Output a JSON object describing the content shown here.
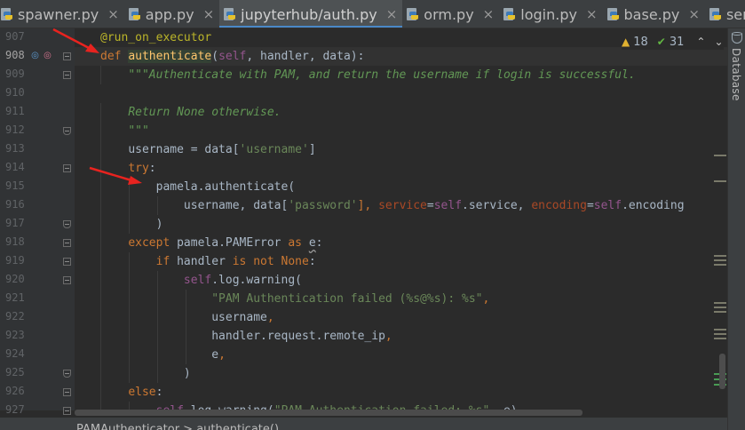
{
  "tabs": [
    {
      "label": "spawner.py",
      "active": false
    },
    {
      "label": "app.py",
      "active": false
    },
    {
      "label": "jupyterhub/auth.py",
      "active": true
    },
    {
      "label": "orm.py",
      "active": false
    },
    {
      "label": "login.py",
      "active": false
    },
    {
      "label": "base.py",
      "active": false
    },
    {
      "label": "service",
      "active": false
    }
  ],
  "inspection": {
    "warnings": "18",
    "weak_warnings": "31"
  },
  "side_panel": {
    "database_label": "Database"
  },
  "breadcrumb": {
    "text": "PAMAuthenticator > authenticate()"
  },
  "colors": {
    "accent": "#4a88c7",
    "arrow": "#e8231f",
    "background": "#2b2b2b"
  },
  "lines": [
    {
      "num": "907",
      "indent": 0,
      "tokens": [
        {
          "t": "@run_on_executor",
          "c": "dec"
        }
      ]
    },
    {
      "num": "908",
      "indent": 0,
      "current": true,
      "tokens": [
        {
          "t": "def",
          "c": "kw"
        },
        {
          "t": " "
        },
        {
          "t": "authenticate",
          "c": "fnhl"
        },
        {
          "t": "("
        },
        {
          "t": "self",
          "c": "slf"
        },
        {
          "t": ", handler, data):"
        }
      ]
    },
    {
      "num": "909",
      "indent": 1,
      "tokens": [
        {
          "t": "\"\"\"Authenticate with PAM, and return the username if login is successful.",
          "c": "doc"
        }
      ]
    },
    {
      "num": "910",
      "indent": 0,
      "tokens": []
    },
    {
      "num": "911",
      "indent": 1,
      "tokens": [
        {
          "t": "Return None otherwise.",
          "c": "doc"
        }
      ]
    },
    {
      "num": "912",
      "indent": 1,
      "tokens": [
        {
          "t": "\"\"\"",
          "c": "doc"
        }
      ]
    },
    {
      "num": "913",
      "indent": 1,
      "tokens": [
        {
          "t": "username = data["
        },
        {
          "t": "'username'",
          "c": "str"
        },
        {
          "t": "]"
        }
      ]
    },
    {
      "num": "914",
      "indent": 1,
      "tokens": [
        {
          "t": "try",
          "c": "kw"
        },
        {
          "t": ":"
        }
      ]
    },
    {
      "num": "915",
      "indent": 2,
      "tokens": [
        {
          "t": "pamela.authenticate("
        }
      ]
    },
    {
      "num": "916",
      "indent": 3,
      "tokens": [
        {
          "t": "username, data["
        },
        {
          "t": "'password'",
          "c": "str"
        },
        {
          "t": "], ",
          "c": "kw"
        },
        {
          "t": "service",
          "c": "kwarg"
        },
        {
          "t": "="
        },
        {
          "t": "self",
          "c": "slf"
        },
        {
          "t": ".service, "
        },
        {
          "t": "encoding",
          "c": "kwarg"
        },
        {
          "t": "="
        },
        {
          "t": "self",
          "c": "slf"
        },
        {
          "t": ".encoding"
        }
      ]
    },
    {
      "num": "917",
      "indent": 2,
      "tokens": [
        {
          "t": ")"
        }
      ]
    },
    {
      "num": "918",
      "indent": 1,
      "tokens": [
        {
          "t": "except",
          "c": "kw"
        },
        {
          "t": " pamela.PAMError "
        },
        {
          "t": "as",
          "c": "kw"
        },
        {
          "t": " "
        },
        {
          "t": "e",
          "c": "tl"
        },
        {
          "t": ":"
        }
      ]
    },
    {
      "num": "919",
      "indent": 2,
      "tokens": [
        {
          "t": "if",
          "c": "kw"
        },
        {
          "t": " handler "
        },
        {
          "t": "is not None",
          "c": "kw"
        },
        {
          "t": ":"
        }
      ]
    },
    {
      "num": "920",
      "indent": 3,
      "tokens": [
        {
          "t": "self",
          "c": "slf"
        },
        {
          "t": ".log.warning("
        }
      ]
    },
    {
      "num": "921",
      "indent": 4,
      "tokens": [
        {
          "t": "\"PAM Authentication failed (%s@%s): %s\"",
          "c": "str"
        },
        {
          "t": ",",
          "c": "kw"
        }
      ]
    },
    {
      "num": "922",
      "indent": 4,
      "tokens": [
        {
          "t": "username"
        },
        {
          "t": ",",
          "c": "kw"
        }
      ]
    },
    {
      "num": "923",
      "indent": 4,
      "tokens": [
        {
          "t": "handler.request.remote_ip"
        },
        {
          "t": ",",
          "c": "kw"
        }
      ]
    },
    {
      "num": "924",
      "indent": 4,
      "tokens": [
        {
          "t": "e"
        },
        {
          "t": ",",
          "c": "kw"
        }
      ]
    },
    {
      "num": "925",
      "indent": 3,
      "tokens": [
        {
          "t": ")"
        }
      ]
    },
    {
      "num": "926",
      "indent": 1,
      "tokens": [
        {
          "t": "else",
          "c": "kw"
        },
        {
          "t": ":"
        }
      ]
    },
    {
      "num": "927",
      "indent": 2,
      "tokens": [
        {
          "t": "self",
          "c": "slf"
        },
        {
          "t": ".log.warning("
        },
        {
          "t": "\"PAM Authentication failed: %s\"",
          "c": "str"
        },
        {
          "t": ", e)",
          "c": ""
        }
      ]
    }
  ]
}
